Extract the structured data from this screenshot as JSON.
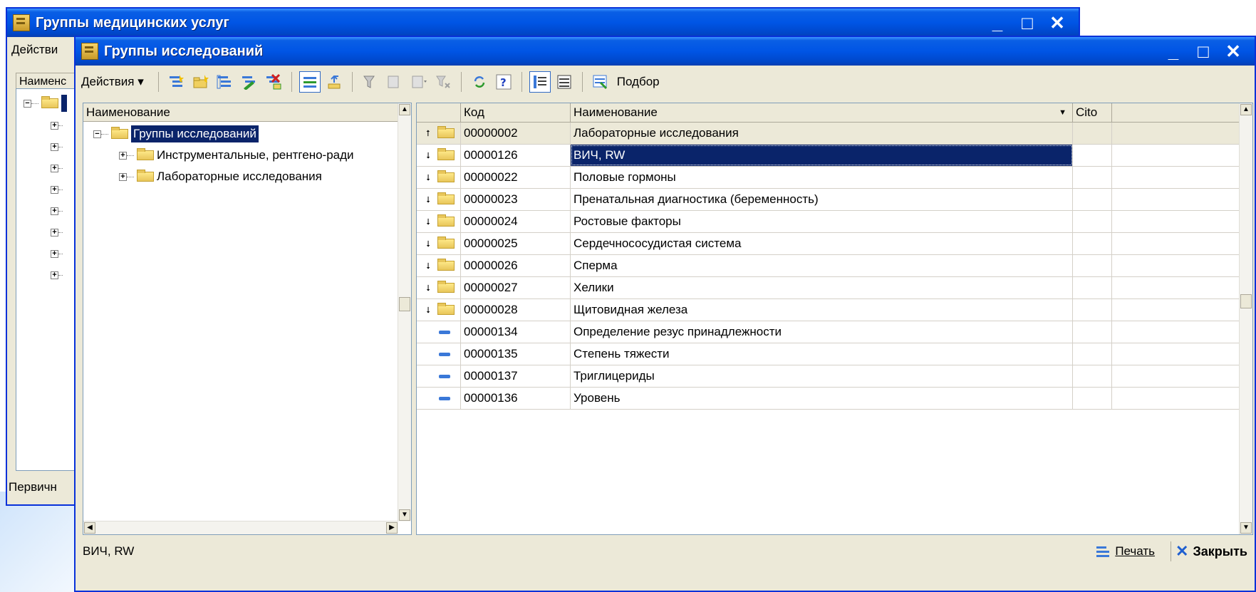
{
  "back_window": {
    "title": "Группы медицинских услуг",
    "menu_label": "Действи",
    "column_header": "Наименс",
    "footer_label": "Первичн",
    "controls": {
      "minimize": "_",
      "maximize": "□",
      "close": "✕"
    }
  },
  "front_window": {
    "title": "Группы исследований",
    "controls": {
      "minimize": "_",
      "maximize": "□",
      "close": "✕"
    },
    "toolbar": {
      "actions_label": "Действия ▾",
      "select_label": "Подбор"
    },
    "tree": {
      "header": "Наименование",
      "root": "Группы исследований",
      "children": [
        "Инструментальные, рентгено-ради",
        "Лабораторные исследования"
      ]
    },
    "grid": {
      "columns": [
        "",
        "Код",
        "Наименование",
        "Cito"
      ],
      "rows": [
        {
          "code": "00000002",
          "name": "Лабораторные исследования",
          "kind": "up"
        },
        {
          "code": "00000126",
          "name": "ВИЧ, RW",
          "kind": "group"
        },
        {
          "code": "00000022",
          "name": "Половые гормоны",
          "kind": "group"
        },
        {
          "code": "00000023",
          "name": "Пренатальная диагностика (беременность)",
          "kind": "group"
        },
        {
          "code": "00000024",
          "name": "Ростовые факторы",
          "kind": "group"
        },
        {
          "code": "00000025",
          "name": "Сердечнососудистая система",
          "kind": "group"
        },
        {
          "code": "00000026",
          "name": "Сперма",
          "kind": "group"
        },
        {
          "code": "00000027",
          "name": "Хелики",
          "kind": "group"
        },
        {
          "code": "00000028",
          "name": "Щитовидная железа",
          "kind": "group"
        },
        {
          "code": "00000134",
          "name": "Определение резус принадлежности",
          "kind": "item"
        },
        {
          "code": "00000135",
          "name": "Степень тяжести",
          "kind": "item"
        },
        {
          "code": "00000137",
          "name": "Триглицериды",
          "kind": "item"
        },
        {
          "code": "00000136",
          "name": "Уровень",
          "kind": "item"
        }
      ]
    },
    "status_text": "ВИЧ, RW",
    "print_label": "Печать",
    "close_label": "Закрыть"
  }
}
